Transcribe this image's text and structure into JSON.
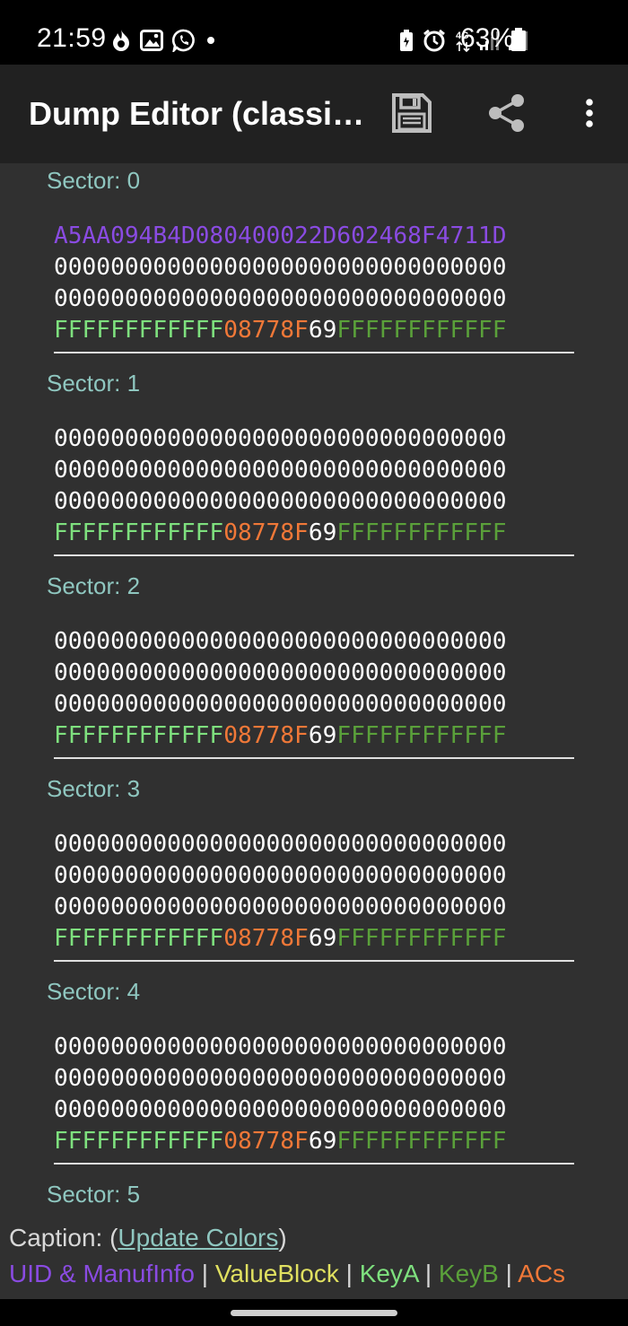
{
  "status_bar": {
    "time": "21:59",
    "battery": "63%",
    "network": "4G",
    "left_icons": [
      "fire-icon",
      "gallery-icon",
      "whatsapp-icon",
      "dot-icon"
    ],
    "right_icons": [
      "battery-saver-icon",
      "alarm-icon",
      "4g-icon",
      "signal-icon",
      "signal-icon",
      "battery-icon"
    ]
  },
  "app_bar": {
    "title": "Dump Editor (classi…",
    "actions": [
      "save-icon",
      "share-icon",
      "more-vert-icon"
    ]
  },
  "sectors": [
    {
      "label": "Sector: 0",
      "blocks": [
        [
          {
            "t": "A5AA094B4D080400022D602468F4711D",
            "c": "uid"
          }
        ],
        [
          {
            "t": "00000000000000000000000000000000",
            "c": "plain"
          }
        ],
        [
          {
            "t": "00000000000000000000000000000000",
            "c": "plain"
          }
        ],
        [
          {
            "t": "FFFFFFFFFFFF",
            "c": "keya"
          },
          {
            "t": "08778F",
            "c": "ac"
          },
          {
            "t": "69",
            "c": "gpb"
          },
          {
            "t": "FFFFFFFFFFFF",
            "c": "keyb"
          }
        ]
      ]
    },
    {
      "label": "Sector: 1",
      "blocks": [
        [
          {
            "t": "00000000000000000000000000000000",
            "c": "plain"
          }
        ],
        [
          {
            "t": "00000000000000000000000000000000",
            "c": "plain"
          }
        ],
        [
          {
            "t": "00000000000000000000000000000000",
            "c": "plain"
          }
        ],
        [
          {
            "t": "FFFFFFFFFFFF",
            "c": "keya"
          },
          {
            "t": "08778F",
            "c": "ac"
          },
          {
            "t": "69",
            "c": "gpb"
          },
          {
            "t": "FFFFFFFFFFFF",
            "c": "keyb"
          }
        ]
      ]
    },
    {
      "label": "Sector: 2",
      "blocks": [
        [
          {
            "t": "00000000000000000000000000000000",
            "c": "plain"
          }
        ],
        [
          {
            "t": "00000000000000000000000000000000",
            "c": "plain"
          }
        ],
        [
          {
            "t": "00000000000000000000000000000000",
            "c": "plain"
          }
        ],
        [
          {
            "t": "FFFFFFFFFFFF",
            "c": "keya"
          },
          {
            "t": "08778F",
            "c": "ac"
          },
          {
            "t": "69",
            "c": "gpb"
          },
          {
            "t": "FFFFFFFFFFFF",
            "c": "keyb"
          }
        ]
      ]
    },
    {
      "label": "Sector: 3",
      "blocks": [
        [
          {
            "t": "00000000000000000000000000000000",
            "c": "plain"
          }
        ],
        [
          {
            "t": "00000000000000000000000000000000",
            "c": "plain"
          }
        ],
        [
          {
            "t": "00000000000000000000000000000000",
            "c": "plain"
          }
        ],
        [
          {
            "t": "FFFFFFFFFFFF",
            "c": "keya"
          },
          {
            "t": "08778F",
            "c": "ac"
          },
          {
            "t": "69",
            "c": "gpb"
          },
          {
            "t": "FFFFFFFFFFFF",
            "c": "keyb"
          }
        ]
      ]
    },
    {
      "label": "Sector: 4",
      "blocks": [
        [
          {
            "t": "00000000000000000000000000000000",
            "c": "plain"
          }
        ],
        [
          {
            "t": "00000000000000000000000000000000",
            "c": "plain"
          }
        ],
        [
          {
            "t": "00000000000000000000000000000000",
            "c": "plain"
          }
        ],
        [
          {
            "t": "FFFFFFFFFFFF",
            "c": "keya"
          },
          {
            "t": "08778F",
            "c": "ac"
          },
          {
            "t": "69",
            "c": "gpb"
          },
          {
            "t": "FFFFFFFFFFFF",
            "c": "keyb"
          }
        ]
      ]
    },
    {
      "label": "Sector: 5",
      "blocks": []
    }
  ],
  "caption": {
    "prefix": "Caption: (",
    "link": "Update Colors",
    "suffix": ")"
  },
  "legend": {
    "uid": "UID & ManufInfo",
    "value_block": "ValueBlock",
    "key_a": "KeyA",
    "key_b": "KeyB",
    "acs": "ACs",
    "separator": " | "
  },
  "colors": {
    "uid": "#8a4be2",
    "value_block": "#e0e060",
    "key_a": "#7ee07e",
    "key_b": "#5aa03a",
    "acs": "#f07838",
    "sector_label": "#8fc7c0",
    "background": "#303030",
    "app_bar": "#212121"
  }
}
